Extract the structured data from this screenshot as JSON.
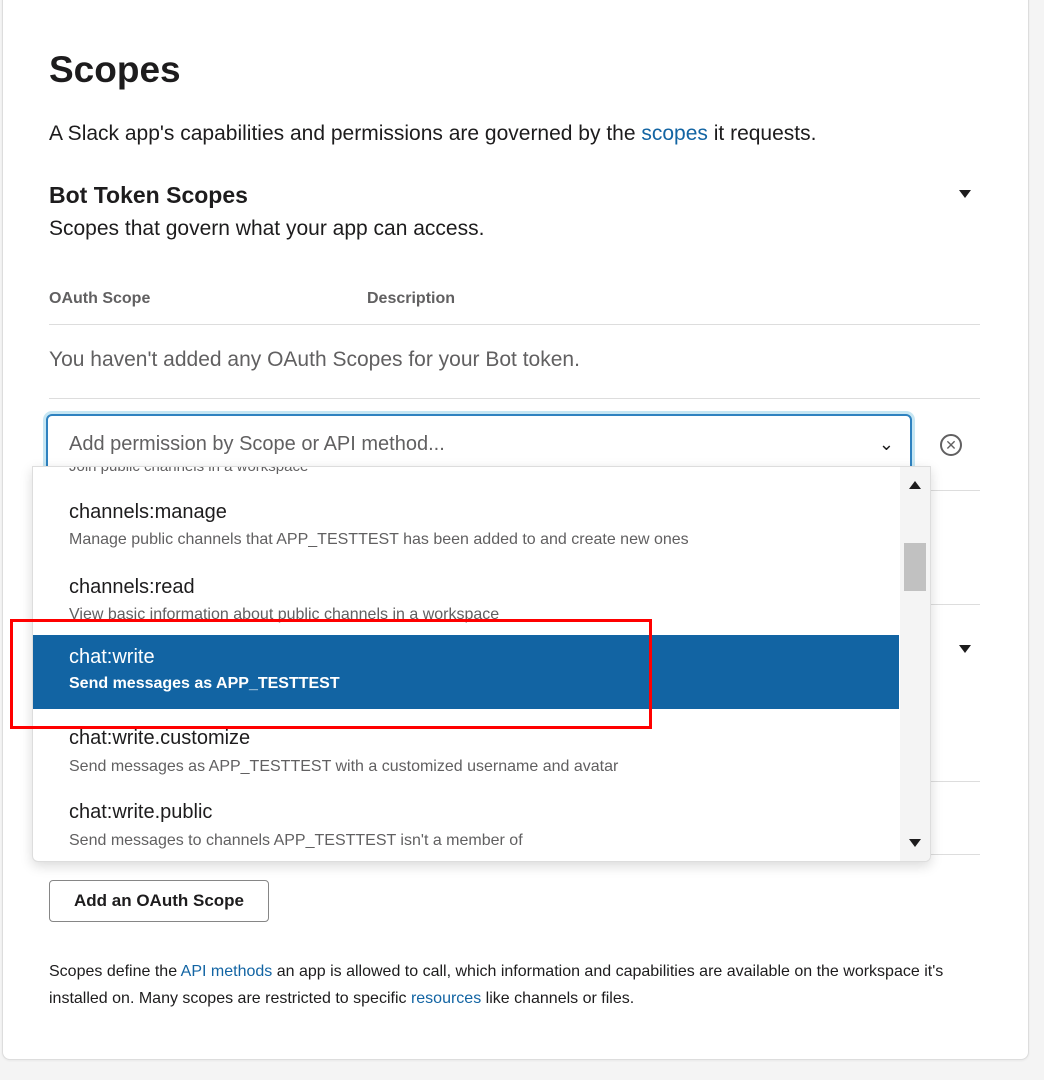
{
  "header": {
    "title": "Scopes",
    "intro_before": "A Slack app's capabilities and permissions are governed by the ",
    "intro_link": "scopes",
    "intro_after": " it requests."
  },
  "bot_token": {
    "title": "Bot Token Scopes",
    "description": "Scopes that govern what your app can access.",
    "col_scope": "OAuth Scope",
    "col_description": "Description",
    "empty_message": "You haven't added any OAuth Scopes for your Bot token."
  },
  "search": {
    "placeholder": "Add permission by Scope or API method..."
  },
  "dropdown": {
    "partial_text": "Join public channels in a workspace",
    "options": [
      {
        "name": "channels:manage",
        "description": "Manage public channels that APP_TESTTEST has been added to and create new ones"
      },
      {
        "name": "channels:read",
        "description": "View basic information about public channels in a workspace"
      },
      {
        "name": "chat:write",
        "description": "Send messages as APP_TESTTEST",
        "selected": true
      },
      {
        "name": "chat:write.customize",
        "description": "Send messages as APP_TESTTEST with a customized username and avatar"
      },
      {
        "name": "chat:write.public",
        "description": "Send messages to channels APP_TESTTEST isn't a member of"
      }
    ]
  },
  "buttons": {
    "add_scope": "Add an OAuth Scope"
  },
  "footer": {
    "part1": "Scopes define the ",
    "link1": "API methods",
    "part2": " an app is allowed to call, which information and capabilities are available on the workspace it's installed on. Many scopes are restricted to specific ",
    "link2": "resources",
    "part3": " like channels or files."
  },
  "colors": {
    "accent": "#1264a3",
    "highlight_border": "#ff0000"
  }
}
